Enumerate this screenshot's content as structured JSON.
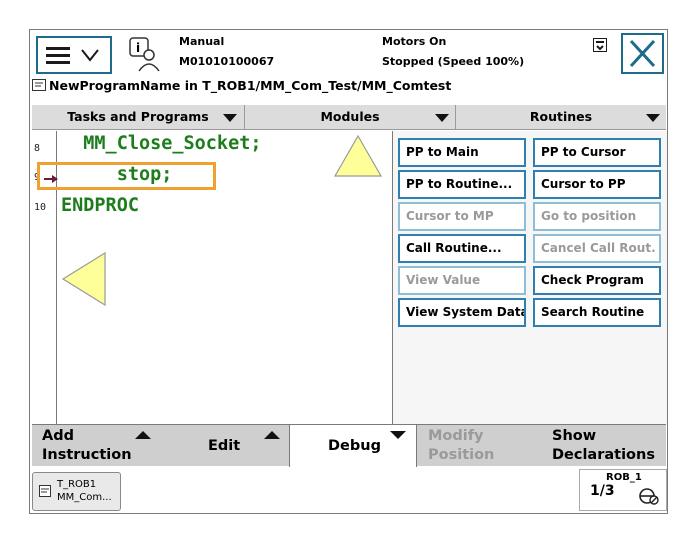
{
  "status": {
    "mode": "Manual",
    "controller_id": "M01010100067",
    "motor_state": "Motors On",
    "run_state": "Stopped (Speed 100%)"
  },
  "program_path": "NewProgramName  in  T_ROB1/MM_Com_Test/MM_Comtest",
  "tabs": [
    {
      "label": "Tasks and Programs"
    },
    {
      "label": "Modules"
    },
    {
      "label": "Routines"
    }
  ],
  "editor": {
    "lines": [
      {
        "number": "8",
        "code": "  MM_Close_Socket;"
      },
      {
        "number": "9",
        "code": "     stop;"
      },
      {
        "number": "10",
        "code": "ENDPROC"
      }
    ]
  },
  "debug_menu": [
    {
      "label": "PP to Main",
      "enabled": true
    },
    {
      "label": "PP to Cursor",
      "enabled": true
    },
    {
      "label": "PP to Routine...",
      "enabled": true
    },
    {
      "label": "Cursor to PP",
      "enabled": true
    },
    {
      "label": "Cursor to MP",
      "enabled": false
    },
    {
      "label": "Go to position",
      "enabled": false
    },
    {
      "label": "Call Routine...",
      "enabled": true
    },
    {
      "label": "Cancel Call Rout.",
      "enabled": false
    },
    {
      "label": "View Value",
      "enabled": false
    },
    {
      "label": "Check Program",
      "enabled": true
    },
    {
      "label": "View System Data",
      "enabled": true
    },
    {
      "label": "Search Routine",
      "enabled": true
    }
  ],
  "toolbar": {
    "add_l1": "Add",
    "add_l2": "Instruction",
    "edit": "Edit",
    "debug": "Debug",
    "modify_l1": "Modify",
    "modify_l2": "Position",
    "show_l1": "Show",
    "show_l2": "Declarations"
  },
  "taskbar": {
    "task_l1": "T_ROB1",
    "task_l2": "MM_Com...",
    "quickset_unit": "ROB_1",
    "quickset_fraction": "1/3"
  },
  "colors": {
    "accent": "#1f6b8c",
    "code_green": "#1d7d1d",
    "cursor_orange": "#f0a030",
    "hint_triangle": "#ffff99"
  }
}
